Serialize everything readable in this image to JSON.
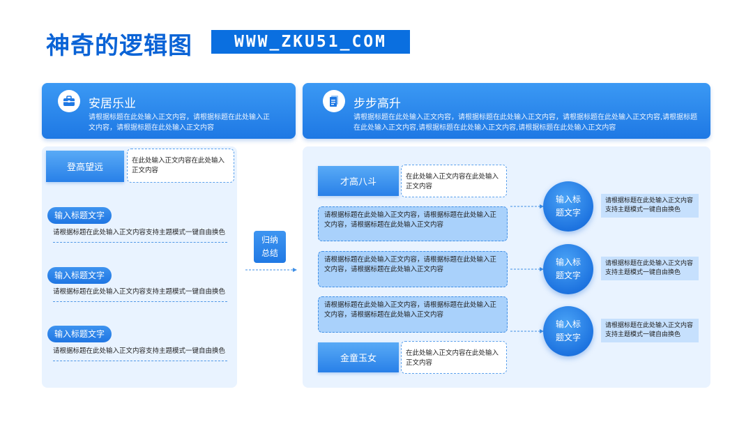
{
  "title": "神奇的逻辑图",
  "url": "WWW_ZKU51_COM",
  "left_panel": {
    "header": {
      "icon": "briefcase-icon",
      "title": "安居乐业",
      "text": "请根据标题在此处输入正文内容，请根据标题在此处输入正文内容，请根据标题在此处输入正文内容"
    },
    "tag": {
      "label": "登高望远",
      "text": "在此处输入正文内容在此处输入正文内容"
    },
    "items": [
      {
        "pill": "输入标题文字",
        "desc": "请根据标题在此处输入正文内容支持主题模式一键自由换色"
      },
      {
        "pill": "输入标题文字",
        "desc": "请根据标题在此处输入正文内容支持主题模式一键自由换色"
      },
      {
        "pill": "输入标题文字",
        "desc": "请根据标题在此处输入正文内容支持主题模式一键自由换色"
      }
    ]
  },
  "middle": {
    "line1": "归纳",
    "line2": "总结"
  },
  "right_panel": {
    "header": {
      "icon": "document-icon",
      "title": "步步高升",
      "text": "请根据标题在此处输入正文内容，请根据标题在此处输入正文内容，请根据标题在此处输入正文内容,请根据标题在此处输入正文内容,请根据标题在此处输入正文内容,请根据标题在此处输入正文内容"
    },
    "top_tag": {
      "label": "才高八斗",
      "text": "在此处输入正文内容在此处输入正文内容"
    },
    "bottom_tag": {
      "label": "金童玉女",
      "text": "在此处输入正文内容在此处输入正文内容"
    },
    "boxes": [
      "请根据标题在此处输入正文内容，请根据标题在此处输入正文内容，请根据标题在此处输入正文内容",
      "请根据标题在此处输入正文内容，请根据标题在此处输入正文内容，请根据标题在此处输入正文内容",
      "请根据标题在此处输入正文内容，请根据标题在此处输入正文内容，请根据标题在此处输入正文内容"
    ],
    "circles": [
      {
        "line1": "输入标",
        "line2": "题文字",
        "side": "请根据标题在此处输入正文内容支持主题模式一键自由换色"
      },
      {
        "line1": "输入标",
        "line2": "题文字",
        "side": "请根据标题在此处输入正文内容支持主题模式一键自由换色"
      },
      {
        "line1": "输入标",
        "line2": "题文字",
        "side": "请根据标题在此处输入正文内容支持主题模式一键自由换色"
      }
    ]
  },
  "colors": {
    "primary": "#1e78e4",
    "light": "#e9f3ff",
    "box": "#a9d1fb",
    "title": "#0a63d6"
  }
}
